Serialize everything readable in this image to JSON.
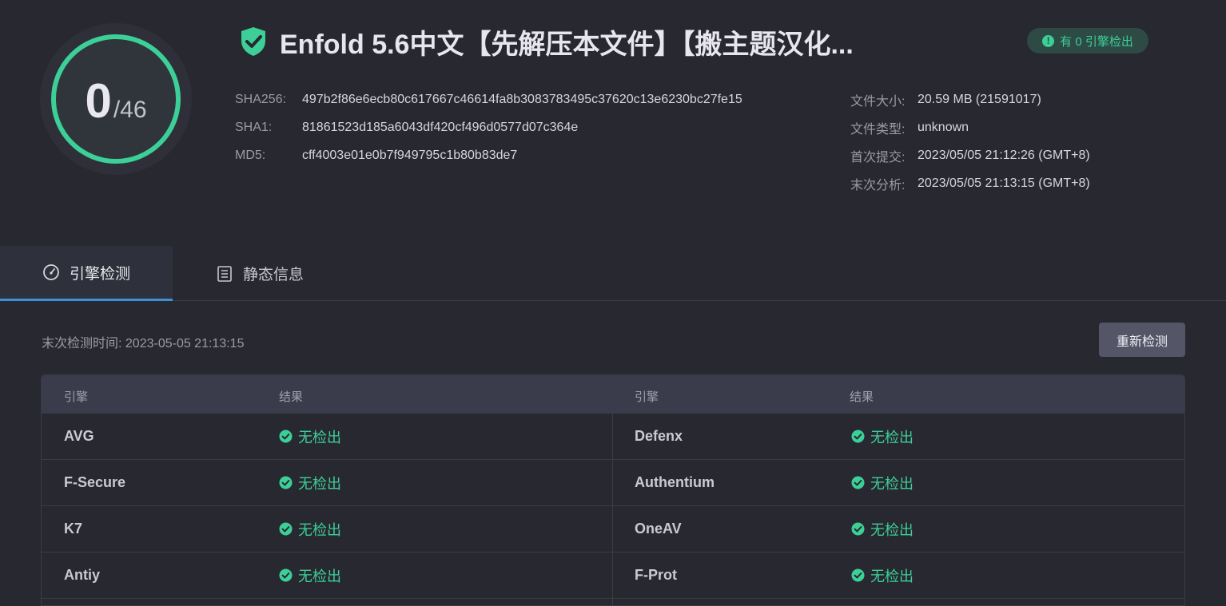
{
  "score": {
    "detected": "0",
    "total": "/46"
  },
  "file": {
    "title": "Enfold 5.6中文【先解压本文件】【搬主题汉化...",
    "badge": "有 0 引擎检出"
  },
  "hashes": [
    {
      "key": "SHA256:",
      "value": "497b2f86e6ecb80c617667c46614fa8b3083783495c37620c13e6230bc27fe15"
    },
    {
      "key": "SHA1:",
      "value": "81861523d185a6043df420cf496d0577d07c364e"
    },
    {
      "key": "MD5:",
      "value": "cff4003e01e0b7f949795c1b80b83de7"
    }
  ],
  "meta": [
    {
      "key": "文件大小:",
      "value": "20.59 MB (21591017)"
    },
    {
      "key": "文件类型:",
      "value": "unknown"
    },
    {
      "key": "首次提交:",
      "value": "2023/05/05 21:12:26 (GMT+8)"
    },
    {
      "key": "末次分析:",
      "value": "2023/05/05 21:13:15 (GMT+8)"
    }
  ],
  "tabs": {
    "engine": "引擎检测",
    "static": "静态信息"
  },
  "scan": {
    "last_check": "末次检测时间: 2023-05-05 21:13:15",
    "recheck_label": "重新检测"
  },
  "table": {
    "headers": {
      "engine": "引擎",
      "result": "结果"
    },
    "rows": [
      {
        "left": {
          "engine": "AVG",
          "result": "无检出"
        },
        "right": {
          "engine": "Defenx",
          "result": "无检出"
        }
      },
      {
        "left": {
          "engine": "F-Secure",
          "result": "无检出"
        },
        "right": {
          "engine": "Authentium",
          "result": "无检出"
        }
      },
      {
        "left": {
          "engine": "K7",
          "result": "无检出"
        },
        "right": {
          "engine": "OneAV",
          "result": "无检出"
        }
      },
      {
        "left": {
          "engine": "Antiy",
          "result": "无检出"
        },
        "right": {
          "engine": "F-Prot",
          "result": "无检出"
        }
      }
    ]
  },
  "colors": {
    "accent_green": "#3ccf97",
    "tab_underline": "#3f8fd6",
    "background": "#282831"
  },
  "icons": {
    "title": "shield-check-icon",
    "badge": "exclamation-circle-icon",
    "engine_tab": "gauge-icon",
    "static_tab": "list-document-icon",
    "result": "check-circle-icon"
  }
}
